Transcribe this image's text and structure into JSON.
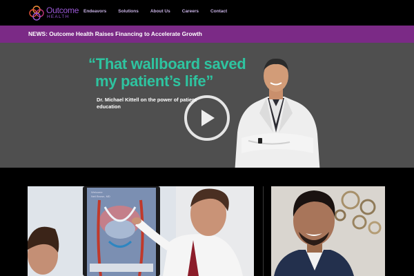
{
  "brand": {
    "name": "Outcome",
    "subname": "HEALTH",
    "purple": "#9b59d6",
    "orange": "#f28c38"
  },
  "nav": {
    "items": [
      {
        "label": "Endeavors"
      },
      {
        "label": "Solutions"
      },
      {
        "label": "About Us"
      },
      {
        "label": "Careers"
      },
      {
        "label": "Contact"
      }
    ]
  },
  "news": {
    "text": "NEWS: Outcome Health Raises Financing to Accelerate Growth",
    "bar_color": "#7b2a86"
  },
  "hero": {
    "quote_line1": "“That wallboard saved",
    "quote_line2": "my patient’s life”",
    "caption": "Dr. Michael Kittell on the power of patient education",
    "quote_color": "#2ec4a0",
    "play_icon": "play-icon"
  },
  "cards": {
    "card1_screen_text": "Welcome",
    "card1_screen_sub": "Neil Brown, MD"
  }
}
